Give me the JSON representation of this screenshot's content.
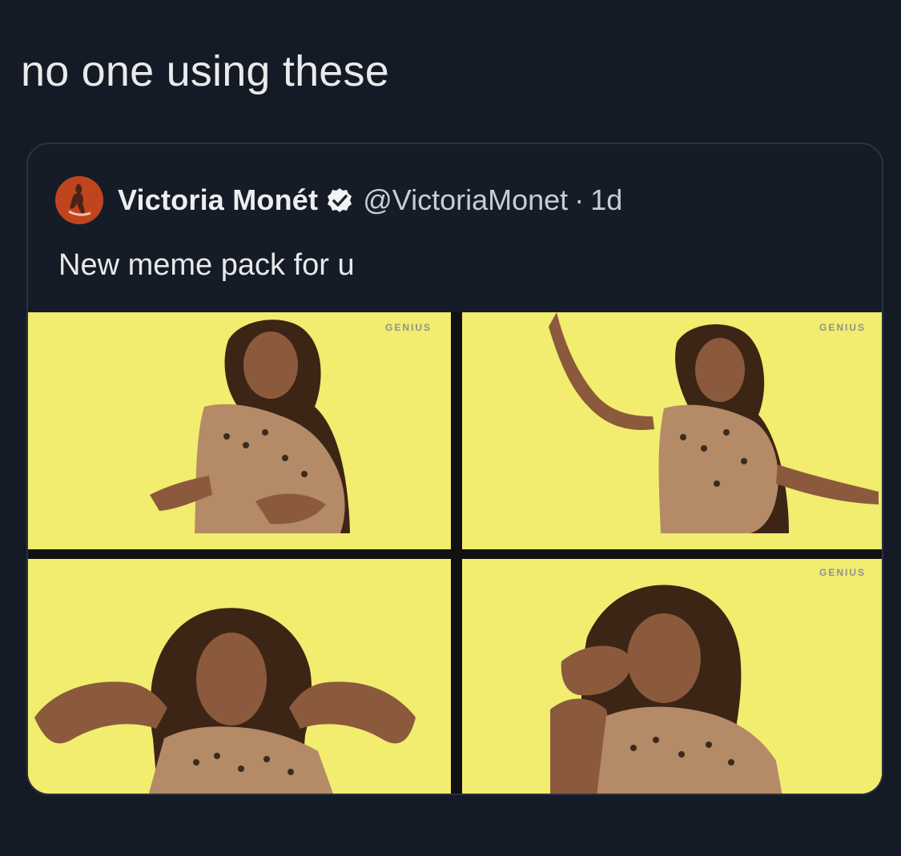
{
  "post": {
    "caption": "no one using these"
  },
  "quoted_tweet": {
    "display_name": "Victoria Monét",
    "handle": "@VictoriaMonet",
    "separator": "·",
    "age": "1d",
    "text": "New meme pack for u",
    "verified": true
  },
  "media": {
    "watermark": "GENIUS",
    "tiles": [
      {
        "label": "meme-image-1"
      },
      {
        "label": "meme-image-2"
      },
      {
        "label": "meme-image-3"
      },
      {
        "label": "meme-image-4"
      }
    ]
  },
  "colors": {
    "background": "#141b26",
    "card_border": "#2a3340",
    "verified_badge": "#f1f3f5",
    "media_background": "#f2ec6f",
    "avatar": "#c0451f"
  }
}
